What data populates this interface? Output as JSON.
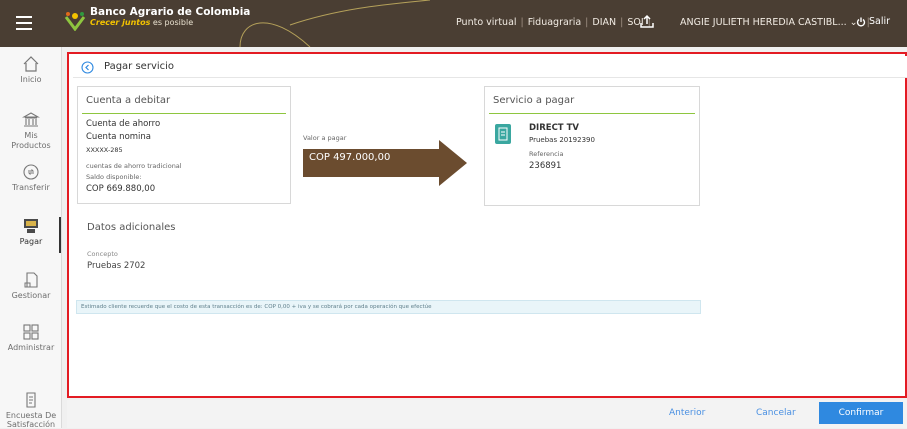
{
  "header": {
    "brand_name": "Banco Agrario de Colombia",
    "slogan_bold": "Crecer juntos",
    "slogan_rest": " es posible",
    "links": [
      "Punto virtual",
      "Fiduagraria",
      "DIAN",
      "SOI"
    ],
    "user_name": "ANGIE JULIETH HEREDIA CASTIBL...",
    "logout_label": "Salir"
  },
  "sidebar": {
    "items": [
      {
        "label": "Inicio",
        "icon": "home-icon"
      },
      {
        "label": "Mis Productos",
        "icon": "bank-icon"
      },
      {
        "label": "Transferir",
        "icon": "transfer-icon"
      },
      {
        "label": "Pagar",
        "icon": "pay-icon",
        "active": true
      },
      {
        "label": "Gestionar",
        "icon": "manage-icon"
      },
      {
        "label": "Administrar",
        "icon": "grid-icon"
      },
      {
        "label": "Encuesta De Satisfacción",
        "icon": "survey-icon"
      }
    ]
  },
  "page": {
    "title": "Pagar servicio"
  },
  "debit_account": {
    "title": "Cuenta a debitar",
    "type": "Cuenta de ahorro",
    "name": "Cuenta nomina",
    "number": "XXXXX-285",
    "description": "cuentas de ahorro tradicional",
    "balance_label": "Saldo disponible:",
    "balance": "COP 669.880,00"
  },
  "payment": {
    "label": "Valor a pagar",
    "amount": "COP 497.000,00"
  },
  "service": {
    "title": "Servicio a pagar",
    "name": "DIRECT TV",
    "detail": "Pruebas 20192390",
    "reference_label": "Referencia",
    "reference": "236891"
  },
  "additional": {
    "title": "Datos adicionales",
    "concept_label": "Concepto",
    "concept": "Pruebas 2702"
  },
  "notice": "Estimado cliente recuerde que el costo de esta transacción es de: COP 0,00 + iva y se cobrará por cada operación que efectúe",
  "footer": {
    "previous_label": "Anterior",
    "cancel_label": "Cancelar",
    "confirm_label": "Confirmar"
  },
  "colors": {
    "topbar": "#4a3e33",
    "accent_green": "#8ec63f",
    "highlight_border": "#e31b23",
    "arrow_brown": "#6b4c2f",
    "confirm_blue": "#2f89e0"
  }
}
